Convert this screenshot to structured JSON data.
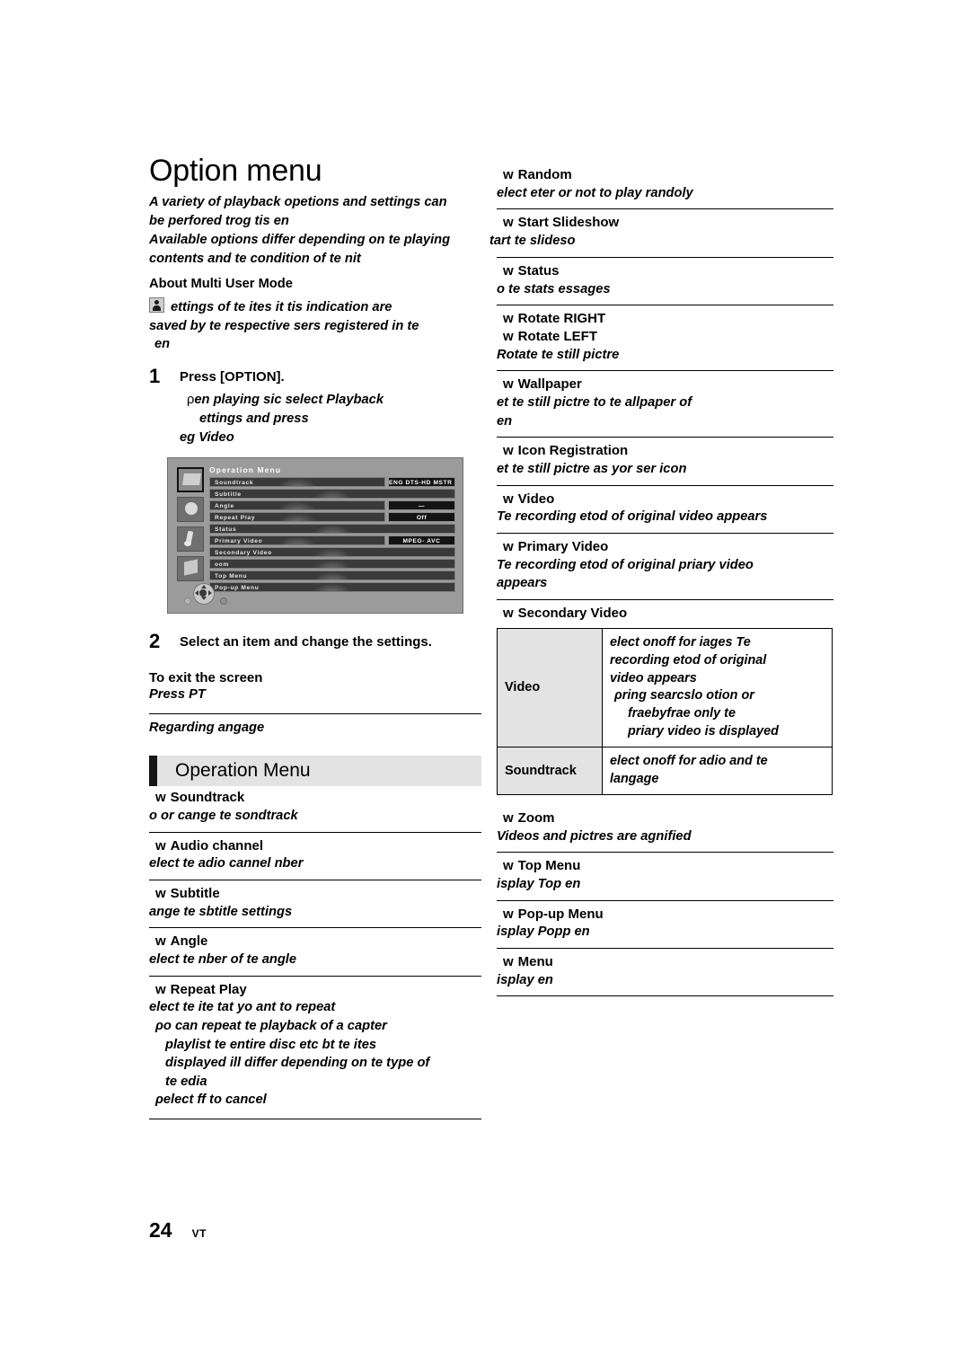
{
  "document": {
    "title": "Option menu",
    "page_number": "24",
    "page_code": "VT"
  },
  "intro": {
    "line1": "A variety of playback opetions and settings can",
    "line2": "be perfored trog tis en",
    "line3": "Available options differ depending on te playing",
    "line4": "contents and te condition of te nit",
    "subhead": "About Multi User Mode",
    "note_icon": "user-icon",
    "note_line1": "ettings of te ites it tis indication are",
    "note_line2": "saved by te respective sers registered in te",
    "note_line3": "en"
  },
  "steps": [
    {
      "number": "1",
      "title": "Press [OPTION].",
      "body_marker": "ρ",
      "body_line1": "en playing sic select Playback",
      "body_line2": "ettings and press",
      "body_line3": "eg Video"
    },
    {
      "number": "2",
      "title": "Select an item and change the settings."
    }
  ],
  "tv_screenshot": {
    "title": "Operation Menu",
    "rows": [
      {
        "label": "Soundtrack",
        "value": "ENG DTS-HD MSTR ..."
      },
      {
        "label": "Subtitle",
        "value": ""
      },
      {
        "label": "Angle",
        "value": "—"
      },
      {
        "label": "Repeat Play",
        "value": "Off"
      },
      {
        "label": "Status",
        "value": ""
      },
      {
        "label": "Primary Video",
        "value": "MPEG- AVC"
      },
      {
        "label": "Secondary Video",
        "value": ""
      },
      {
        "label": "oom",
        "value": ""
      },
      {
        "label": "Top Menu",
        "value": ""
      },
      {
        "label": "Pop-up Menu",
        "value": ""
      }
    ],
    "sidebar_icons": [
      "video-icon",
      "subtitle-icon",
      "audio-icon",
      "other-icon"
    ],
    "dpad": "direction-pad-icon"
  },
  "exit": {
    "title": "To exit the screen",
    "line": "Press PT"
  },
  "regarding": "Regarding angage",
  "section": {
    "heading": "Operation Menu"
  },
  "left_entries": [
    {
      "bullet": "w",
      "title": "Soundtrack",
      "lines": [
        "o or cange te sondtrack"
      ]
    },
    {
      "bullet": "w",
      "title": "Audio channel",
      "lines": [
        "elect te adio cannel nber"
      ]
    },
    {
      "bullet": "w",
      "title": "Subtitle",
      "lines": [
        "ange te sbtitle settings"
      ]
    },
    {
      "bullet": "w",
      "title": "Angle",
      "lines": [
        "elect te nber of te angle"
      ]
    },
    {
      "bullet": "w",
      "title": "Repeat Play",
      "lines": [
        "elect te ite tat yo ant to repeat",
        "ρo can repeat te playback of a capter",
        "playlist te entire disc etc bt te ites",
        "displayed ill differ depending on te type of",
        "te edia",
        "ρelect ff to cancel"
      ]
    }
  ],
  "right_entries_top": [
    {
      "bullet": "w",
      "title": "Random",
      "lines": [
        "elect eter or not to play randoly"
      ]
    },
    {
      "bullet": "w",
      "title": "Start Slideshow",
      "lines": [
        "tart te slideso"
      ]
    },
    {
      "bullet": "w",
      "title": "Status",
      "lines": [
        "o te stats essages"
      ]
    },
    {
      "bullet": "w",
      "title": "Rotate RIGHT",
      "title2": "Rotate LEFT",
      "lines": [
        "Rotate te still pictre"
      ]
    },
    {
      "bullet": "w",
      "title": "Wallpaper",
      "lines": [
        "et te still pictre to te allpaper of",
        "en"
      ]
    },
    {
      "bullet": "w",
      "title": "Icon Registration",
      "lines": [
        "et te still pictre as yor ser icon"
      ]
    },
    {
      "bullet": "w",
      "title": "Video",
      "lines": [
        "Te recording etod of original video appears"
      ]
    },
    {
      "bullet": "w",
      "title": "Primary Video",
      "lines": [
        "Te recording etod of original priary video",
        "appears"
      ]
    },
    {
      "bullet": "w",
      "title": "Secondary Video",
      "lines": []
    }
  ],
  "secondary_video_table": {
    "rows": [
      {
        "key": "Video",
        "value_lines": [
          "elect onoff for iages Te",
          "recording etod of original",
          "video appears",
          "ρring searcslo otion or",
          "fraebyfrae only te",
          "priary video is displayed"
        ]
      },
      {
        "key": "Soundtrack",
        "value_lines": [
          "elect onoff for adio and te",
          "langage"
        ]
      }
    ]
  },
  "right_entries_bottom": [
    {
      "bullet": "w",
      "title": "Zoom",
      "lines": [
        "Videos and pictres are agnified"
      ]
    },
    {
      "bullet": "w",
      "title": "Top Menu",
      "lines": [
        "isplay Top en"
      ]
    },
    {
      "bullet": "w",
      "title": "Pop-up Menu",
      "lines": [
        "isplay Popp en"
      ]
    },
    {
      "bullet": "w",
      "title": "Menu",
      "lines": [
        "isplay en"
      ]
    }
  ]
}
